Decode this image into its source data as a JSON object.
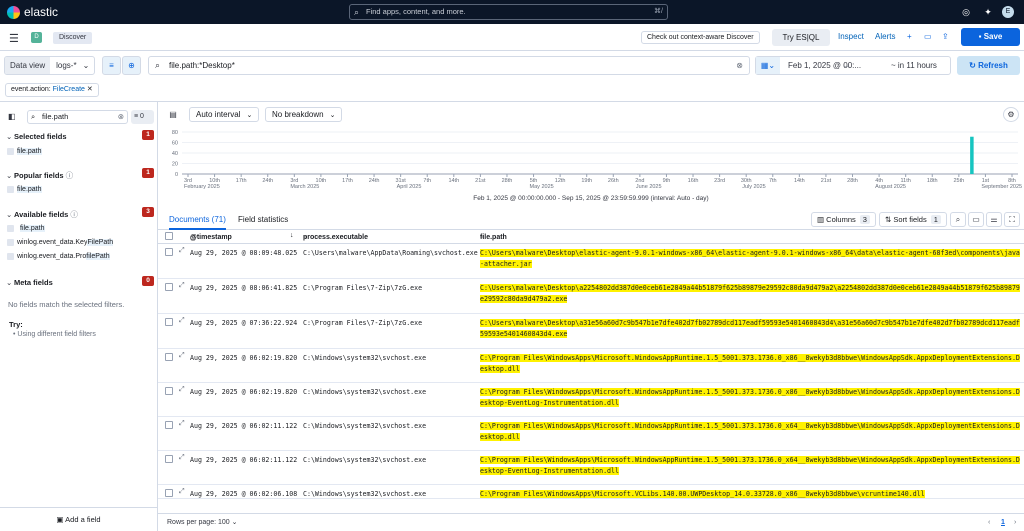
{
  "topbar": {
    "brand": "elastic",
    "search_placeholder": "Find apps, content, and more.",
    "search_shortcut": "⌘/",
    "avatar": "E"
  },
  "subheader": {
    "space_badge": "D",
    "breadcrumb": "Discover",
    "context_button": "Check out context-aware Discover",
    "try_esql": "Try ES|QL",
    "inspect": "Inspect",
    "alerts": "Alerts",
    "save": "Save"
  },
  "query": {
    "data_view_label": "Data view",
    "data_view_value": "logs-*",
    "query_text": "file.path:*Desktop*",
    "date_start": "Feb 1, 2025 @ 00:...",
    "date_arrow": "→",
    "date_end": "~ in 11 hours",
    "refresh": "Refresh"
  },
  "filter_pill": {
    "key": "event.action: ",
    "value": "FileCreate"
  },
  "sidebar": {
    "search_value": "file.path",
    "filter_count": "0",
    "selected": {
      "title": "Selected fields",
      "count": "1",
      "fields": [
        "file.path"
      ]
    },
    "popular": {
      "title": "Popular fields",
      "count": "1",
      "fields": [
        "file.path"
      ]
    },
    "available": {
      "title": "Available fields",
      "count": "3",
      "fields": [
        {
          "pre": "",
          "hl": "file.path",
          "post": ""
        },
        {
          "pre": "winlog.event_data.Key",
          "hl": "FilePath",
          "post": ""
        },
        {
          "pre": "winlog.event_data.Pro",
          "hl": "filePath",
          "post": ""
        }
      ]
    },
    "meta": {
      "title": "Meta fields",
      "count": "0"
    },
    "no_match": "No fields match the selected filters.",
    "try_label": "Try:",
    "try_item": "•  Using different field filters",
    "add_field": "Add a field"
  },
  "chart_toolbar": {
    "interval": "Auto interval",
    "breakdown": "No breakdown"
  },
  "chart_data": {
    "type": "bar",
    "ylim": [
      0,
      80
    ],
    "yticks": [
      "80",
      "60",
      "40",
      "20",
      "0"
    ],
    "xticks": [
      {
        "d": "3rd",
        "m": "February 2025"
      },
      {
        "d": "10th",
        "m": ""
      },
      {
        "d": "17th",
        "m": ""
      },
      {
        "d": "24th",
        "m": ""
      },
      {
        "d": "3rd",
        "m": "March 2025"
      },
      {
        "d": "10th",
        "m": ""
      },
      {
        "d": "17th",
        "m": ""
      },
      {
        "d": "24th",
        "m": ""
      },
      {
        "d": "31st",
        "m": "April 2025"
      },
      {
        "d": "7th",
        "m": ""
      },
      {
        "d": "14th",
        "m": ""
      },
      {
        "d": "21st",
        "m": ""
      },
      {
        "d": "28th",
        "m": ""
      },
      {
        "d": "5th",
        "m": "May 2025"
      },
      {
        "d": "12th",
        "m": ""
      },
      {
        "d": "19th",
        "m": ""
      },
      {
        "d": "26th",
        "m": ""
      },
      {
        "d": "2nd",
        "m": "June 2025"
      },
      {
        "d": "9th",
        "m": ""
      },
      {
        "d": "16th",
        "m": ""
      },
      {
        "d": "23rd",
        "m": ""
      },
      {
        "d": "30th",
        "m": "July 2025"
      },
      {
        "d": "7th",
        "m": ""
      },
      {
        "d": "14th",
        "m": ""
      },
      {
        "d": "21st",
        "m": ""
      },
      {
        "d": "28th",
        "m": ""
      },
      {
        "d": "4th",
        "m": "August 2025"
      },
      {
        "d": "11th",
        "m": ""
      },
      {
        "d": "18th",
        "m": ""
      },
      {
        "d": "25th",
        "m": ""
      },
      {
        "d": "1st",
        "m": "September 2025"
      },
      {
        "d": "8th",
        "m": ""
      }
    ],
    "bars": [
      {
        "x": "Aug 29, 2025",
        "value": 71
      }
    ],
    "now_marker": "Sep 13, 2025",
    "caption": "Feb 1, 2025 @ 00:00:00.000 - Sep 15, 2025 @ 23:59:59.999 (interval: Auto - day)",
    "bar_color": "#16c5c0",
    "marker_color": "#e7664c"
  },
  "tabs": {
    "documents": "Documents (71)",
    "field_stats": "Field statistics",
    "columns": "Columns",
    "columns_count": "3",
    "sort": "Sort fields",
    "sort_count": "1"
  },
  "grid": {
    "headers": {
      "timestamp": "@timestamp",
      "process": "process.executable",
      "path": "file.path"
    },
    "rows": [
      {
        "ts": "Aug 29, 2025 @ 08:09:48.025",
        "proc": "C:\\Users\\malware\\AppData\\Roaming\\svchost.exe",
        "path": "C:\\Users\\malware\\Desktop\\elastic-agent-9.0.1-windows-x86_64\\elastic-agent-9.0.1-windows-x86_64\\data\\elastic-agent-68f3ed\\components\\java-attacher.jar"
      },
      {
        "ts": "Aug 29, 2025 @ 08:06:41.825",
        "proc": "C:\\Program Files\\7-Zip\\7zG.exe",
        "path": "C:\\Users\\malware\\Desktop\\a2254802dd387d0e0ceb61e2849a44b51879f625b89879e29592c80da9d479a2\\a2254802dd387d0e0ceb61e2849a44b51879f625b89879e29592c80da9d479a2.exe"
      },
      {
        "ts": "Aug 29, 2025 @ 07:36:22.924",
        "proc": "C:\\Program Files\\7-Zip\\7zG.exe",
        "path": "C:\\Users\\malware\\Desktop\\a31e56a60d7c9b547b1e7dfe402d7fb02789dcd117eadf59593e5401460843d4\\a31e56a60d7c9b547b1e7dfe402d7fb02789dcd117eadf59593e5401460843d4.exe"
      },
      {
        "ts": "Aug 29, 2025 @ 06:02:19.820",
        "proc": "C:\\Windows\\system32\\svchost.exe",
        "path": "C:\\Program Files\\WindowsApps\\Microsoft.WindowsAppRuntime.1.5_5001.373.1736.0_x86__8wekyb3d8bbwe\\WindowsAppSdk.AppxDeploymentExtensions.Desktop.dll"
      },
      {
        "ts": "Aug 29, 2025 @ 06:02:19.820",
        "proc": "C:\\Windows\\system32\\svchost.exe",
        "path": "C:\\Program Files\\WindowsApps\\Microsoft.WindowsAppRuntime.1.5_5001.373.1736.0_x86__8wekyb3d8bbwe\\WindowsAppSdk.AppxDeploymentExtensions.Desktop-EventLog-Instrumentation.dll"
      },
      {
        "ts": "Aug 29, 2025 @ 06:02:11.122",
        "proc": "C:\\Windows\\system32\\svchost.exe",
        "path": "C:\\Program Files\\WindowsApps\\Microsoft.WindowsAppRuntime.1.5_5001.373.1736.0_x64__8wekyb3d8bbwe\\WindowsAppSdk.AppxDeploymentExtensions.Desktop.dll"
      },
      {
        "ts": "Aug 29, 2025 @ 06:02:11.122",
        "proc": "C:\\Windows\\system32\\svchost.exe",
        "path": "C:\\Program Files\\WindowsApps\\Microsoft.WindowsAppRuntime.1.5_5001.373.1736.0_x64__8wekyb3d8bbwe\\WindowsAppSdk.AppxDeploymentExtensions.Desktop-EventLog-Instrumentation.dll"
      },
      {
        "ts": "Aug 29, 2025 @ 06:02:06.108",
        "proc": "C:\\Windows\\system32\\svchost.exe",
        "path": "C:\\Program Files\\WindowsApps\\Microsoft.VCLibs.140.00.UWPDesktop_14.0.33728.0_x86__8wekyb3d8bbwe\\vcruntime140.dll"
      }
    ]
  },
  "footer": {
    "rows_per_page": "Rows per page: 100",
    "page": "1",
    "prev": "‹",
    "next": "›"
  }
}
